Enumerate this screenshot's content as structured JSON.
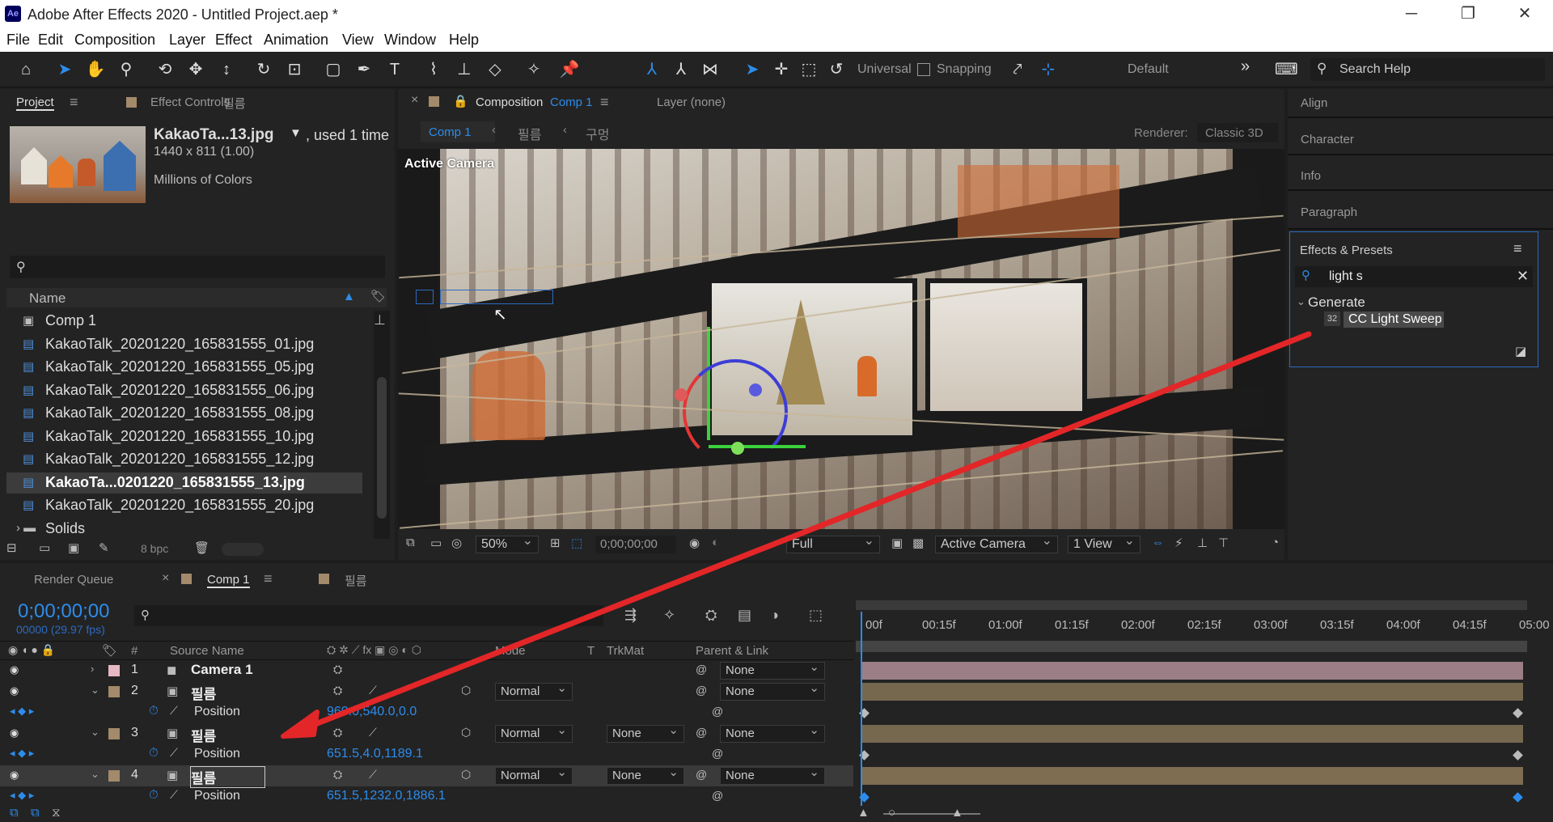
{
  "window": {
    "title": "Adobe After Effects 2020 - Untitled Project.aep *",
    "app_badge": "Ae",
    "minimize": "─",
    "maximize": "❐",
    "close": "✕"
  },
  "menu": [
    "File",
    "Edit",
    "Composition",
    "Layer",
    "Effect",
    "Animation",
    "View",
    "Window",
    "Help"
  ],
  "toolbar": {
    "universal": "Universal",
    "snapping": "Snapping",
    "workspace": "Default",
    "overflow": "»",
    "search_placeholder": "Search Help"
  },
  "project_panel": {
    "tab_project": "Project",
    "tab_effect_controls": "Effect Controls",
    "effect_controls_target": "필름",
    "item_name": "KakaoTa...13.jpg",
    "used": ", used 1 time",
    "dims": "1440 x 811 (1.00)",
    "colors": "Millions of Colors",
    "col_name": "Name",
    "bpc": "8 bpc",
    "items": [
      {
        "name": "Comp 1",
        "type": "comp"
      },
      {
        "name": "KakaoTalk_20201220_165831555_01.jpg",
        "type": "img"
      },
      {
        "name": "KakaoTalk_20201220_165831555_05.jpg",
        "type": "img"
      },
      {
        "name": "KakaoTalk_20201220_165831555_06.jpg",
        "type": "img"
      },
      {
        "name": "KakaoTalk_20201220_165831555_08.jpg",
        "type": "img"
      },
      {
        "name": "KakaoTalk_20201220_165831555_10.jpg",
        "type": "img"
      },
      {
        "name": "KakaoTalk_20201220_165831555_12.jpg",
        "type": "img"
      },
      {
        "name": "KakaoTa...0201220_165831555_13.jpg",
        "type": "img",
        "selected": true
      },
      {
        "name": "KakaoTalk_20201220_165831555_20.jpg",
        "type": "img"
      },
      {
        "name": "Solids",
        "type": "folder"
      }
    ]
  },
  "comp_panel": {
    "tab_label": "Composition",
    "tab_comp": "Comp 1",
    "layer_tab": "Layer (none)",
    "breadcrumb": [
      "Comp 1",
      "필름",
      "구멍"
    ],
    "renderer_label": "Renderer:",
    "renderer": "Classic 3D",
    "view_label": "Active Camera",
    "zoom": "50%",
    "timecode": "0;00;00;00",
    "resolution": "Full",
    "camera": "Active Camera",
    "views": "1 View"
  },
  "right_panels": {
    "align": "Align",
    "character": "Character",
    "info": "Info",
    "paragraph": "Paragraph",
    "effects_presets": "Effects & Presets",
    "search_value": "light s",
    "category": "Generate",
    "effect": "CC Light Sweep",
    "effect_badge": "32"
  },
  "timeline": {
    "tab_render_queue": "Render Queue",
    "tab_comp": "Comp 1",
    "tab_film": "필름",
    "timecode": "0;00;00;00",
    "fps": "00000 (29.97 fps)",
    "headers": {
      "num": "#",
      "source_name": "Source Name",
      "mode": "Mode",
      "t": "T",
      "trkmat": "TrkMat",
      "parent": "Parent & Link"
    },
    "ruler": [
      "00f",
      "00:15f",
      "01:00f",
      "01:15f",
      "02:00f",
      "02:15f",
      "03:00f",
      "03:15f",
      "04:00f",
      "04:15f",
      "05:00"
    ],
    "layers": [
      {
        "num": "1",
        "name": "Camera 1",
        "kind": "camera",
        "mode": "",
        "trkmat": "",
        "parent": "None",
        "color": "#e6b8c4",
        "bar": "#9c7f86"
      },
      {
        "num": "2",
        "name": "필름",
        "kind": "comp",
        "mode": "Normal",
        "trkmat": "",
        "parent": "None",
        "color": "#a38a6a",
        "bar": "#76684f",
        "prop": "Position",
        "value": "960.0,540.0,0.0"
      },
      {
        "num": "3",
        "name": "필름",
        "kind": "comp",
        "mode": "Normal",
        "trkmat": "None",
        "parent": "None",
        "color": "#a38a6a",
        "bar": "#76684f",
        "prop": "Position",
        "value": "651.5,4.0,1189.1"
      },
      {
        "num": "4",
        "name": "필름",
        "kind": "comp",
        "mode": "Normal",
        "trkmat": "None",
        "parent": "None",
        "color": "#a38a6a",
        "bar": "#7f6d52",
        "prop": "Position",
        "value": "651.5,1232.0,1886.1",
        "selected": true
      }
    ]
  },
  "colors": {
    "accent_blue": "#2d8ceb",
    "arrow_red": "#e32628"
  }
}
